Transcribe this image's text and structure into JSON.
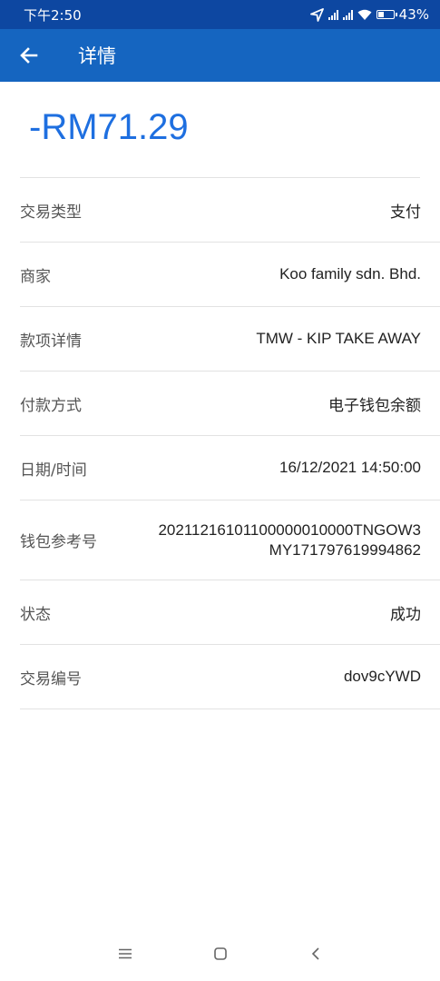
{
  "status_bar": {
    "time": "下午2:50",
    "battery": "43%",
    "battery_level": 0.43
  },
  "app_bar": {
    "title": "详情"
  },
  "amount": "-RM71.29",
  "details": [
    {
      "label": "交易类型",
      "value": "支付"
    },
    {
      "label": "商家",
      "value": "Koo family sdn. Bhd."
    },
    {
      "label": "款项详情",
      "value": "TMW - KIP TAKE AWAY"
    },
    {
      "label": "付款方式",
      "value": "电子钱包余额"
    },
    {
      "label": "日期/时间",
      "value": "16/12/2021 14:50:00"
    },
    {
      "label": "钱包参考号",
      "value_line1": "20211216101100000010000TNGOW3",
      "value_line2": "MY171797619994862"
    },
    {
      "label": "状态",
      "value": "成功"
    },
    {
      "label": "交易编号",
      "value": "dov9cYWD"
    }
  ],
  "colors": {
    "status_bar": "#0d47a1",
    "app_bar": "#1565c0",
    "amount": "#1e6fe0"
  },
  "icons": {
    "back": "arrow-left-icon",
    "location": "navigation-arrow-icon",
    "signal": "signal-icon",
    "wifi": "wifi-icon",
    "battery": "battery-icon",
    "nav_menu": "menu-icon",
    "nav_home": "square-icon",
    "nav_back": "chevron-left-icon"
  }
}
